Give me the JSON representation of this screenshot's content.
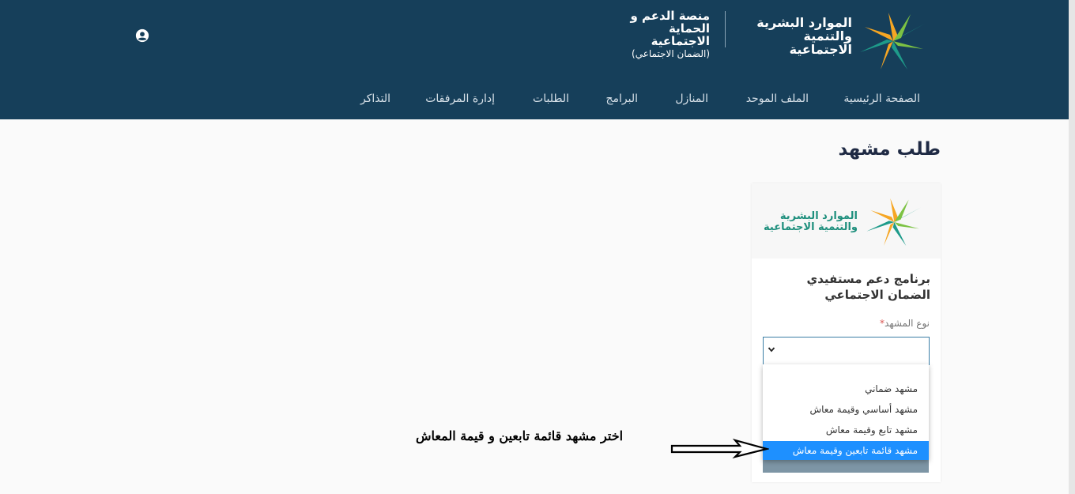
{
  "header": {
    "brand": {
      "line1": "الموارد البشرية",
      "line2": "والتنمية الاجتماعية"
    },
    "platform": {
      "line1": "منصة الدعم و",
      "line2": "الحماية الاجتماعية",
      "line3": "(الضمان الاجتماعي)"
    },
    "user_icon": "user-circle-icon",
    "colors": {
      "background": "#163f5a",
      "logo_orange": "#f6a623",
      "logo_green": "#1e8f7d"
    }
  },
  "nav": {
    "items": [
      {
        "label": "الصفحة الرئيسية"
      },
      {
        "label": "الملف الموحد"
      },
      {
        "label": "المنازل"
      },
      {
        "label": "البرامج"
      },
      {
        "label": "الطلبات"
      },
      {
        "label": "إدارة المرفقات"
      },
      {
        "label": "التذاكر"
      }
    ]
  },
  "page": {
    "title": "طلب مشهد"
  },
  "card": {
    "brand": {
      "line1": "الموارد البشرية",
      "line2": "والتنمية الاجتماعية"
    },
    "heading": "برنامج دعم مستفيدي الضمان الاجتماعي",
    "field_label": "نوع المشهد",
    "required_mark": "*",
    "select_value": "",
    "dropdown_options": [
      {
        "label": ""
      },
      {
        "label": "مشهد ضماني"
      },
      {
        "label": "مشهد أساسي وقيمة معاش"
      },
      {
        "label": "مشهد تابع وقيمة معاش"
      },
      {
        "label": "مشهد قائمة تابعين وقيمة معاش",
        "selected": true
      }
    ]
  },
  "annotation": {
    "text": "اختر مشهد قائمة تابعين و قيمة المعاش"
  }
}
